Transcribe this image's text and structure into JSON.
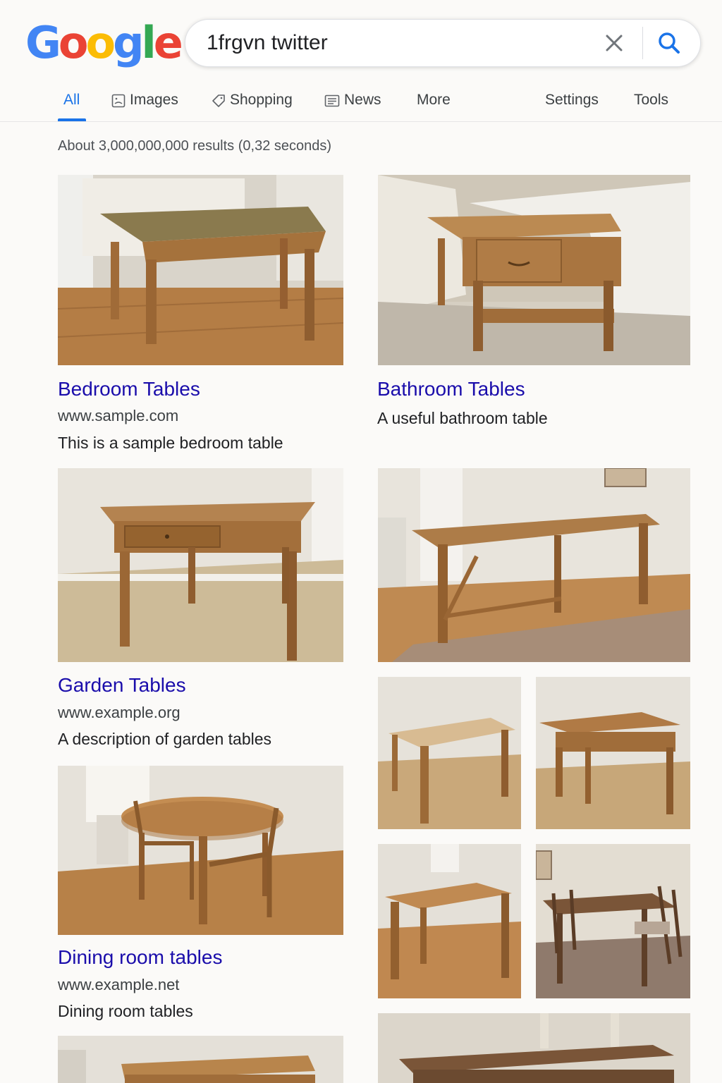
{
  "logo": {
    "text": "Google",
    "colors": [
      "#4285f4",
      "#ea4335",
      "#fbbc05",
      "#4285f4",
      "#34a853",
      "#ea4335"
    ]
  },
  "search": {
    "query": "1frgvn twitter"
  },
  "tabs": [
    {
      "label": "All",
      "icon": ""
    },
    {
      "label": "Images",
      "icon": "image-icon"
    },
    {
      "label": "Shopping",
      "icon": "tag-icon"
    },
    {
      "label": "News",
      "icon": "newspaper-icon"
    },
    {
      "label": "More",
      "icon": ""
    }
  ],
  "tools": {
    "settings": "Settings",
    "tools": "Tools"
  },
  "stats": "About 3,000,000,000 results (0,32 seconds)",
  "results": [
    {
      "title": "Bedroom Tables",
      "url": "www.sample.com",
      "desc": "This is a sample bedroom table"
    },
    {
      "title": "Bathroom Tables",
      "url": "",
      "desc": "A useful bathroom table"
    },
    {
      "title": "Garden Tables",
      "url": "www.example.org",
      "desc": "A description of garden tables"
    },
    {
      "title": "Dining room tables",
      "url": "www.example.net",
      "desc": "Dining room tables"
    }
  ],
  "colors": {
    "link": "#1a0dab",
    "accent": "#1a73e8",
    "wood": "#b07a45"
  }
}
